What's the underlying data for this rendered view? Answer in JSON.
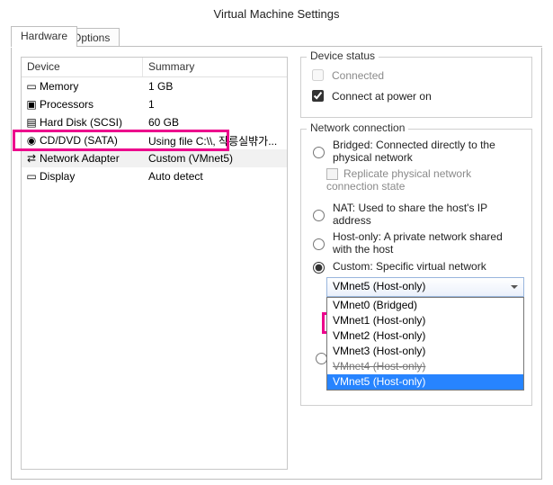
{
  "window": {
    "title": "Virtual Machine Settings"
  },
  "tabs": {
    "hardware": "Hardware",
    "options": "Options"
  },
  "device_list": {
    "col_device": "Device",
    "col_summary": "Summary",
    "rows": [
      {
        "device": "Memory",
        "summary": "1 GB"
      },
      {
        "device": "Processors",
        "summary": "1"
      },
      {
        "device": "Hard Disk (SCSI)",
        "summary": "60 GB"
      },
      {
        "device": "CD/DVD (SATA)",
        "summary": "Using file C:\\\\, 작릉실뱎가..."
      },
      {
        "device": "Network Adapter",
        "summary": "Custom (VMnet5)"
      },
      {
        "device": "Display",
        "summary": "Auto detect"
      }
    ]
  },
  "device_status": {
    "legend": "Device status",
    "connected": "Connected",
    "connect_at_power_on": "Connect at power on"
  },
  "network_connection": {
    "legend": "Network connection",
    "bridged": "Bridged: Connected directly to the physical network",
    "replicate": "Replicate physical network connection state",
    "nat": "NAT: Used to share the host's IP address",
    "host_only": "Host-only: A private network shared with the host",
    "custom": "Custom: Specific virtual network",
    "dropdown_selected": "VMnet5 (Host-only)",
    "dropdown_items": [
      "VMnet0 (Bridged)",
      "VMnet1 (Host-only)",
      "VMnet2 (Host-only)",
      "VMnet3 (Host-only)",
      "VMnet4 (Host-only)",
      "VMnet5 (Host-only)"
    ]
  }
}
